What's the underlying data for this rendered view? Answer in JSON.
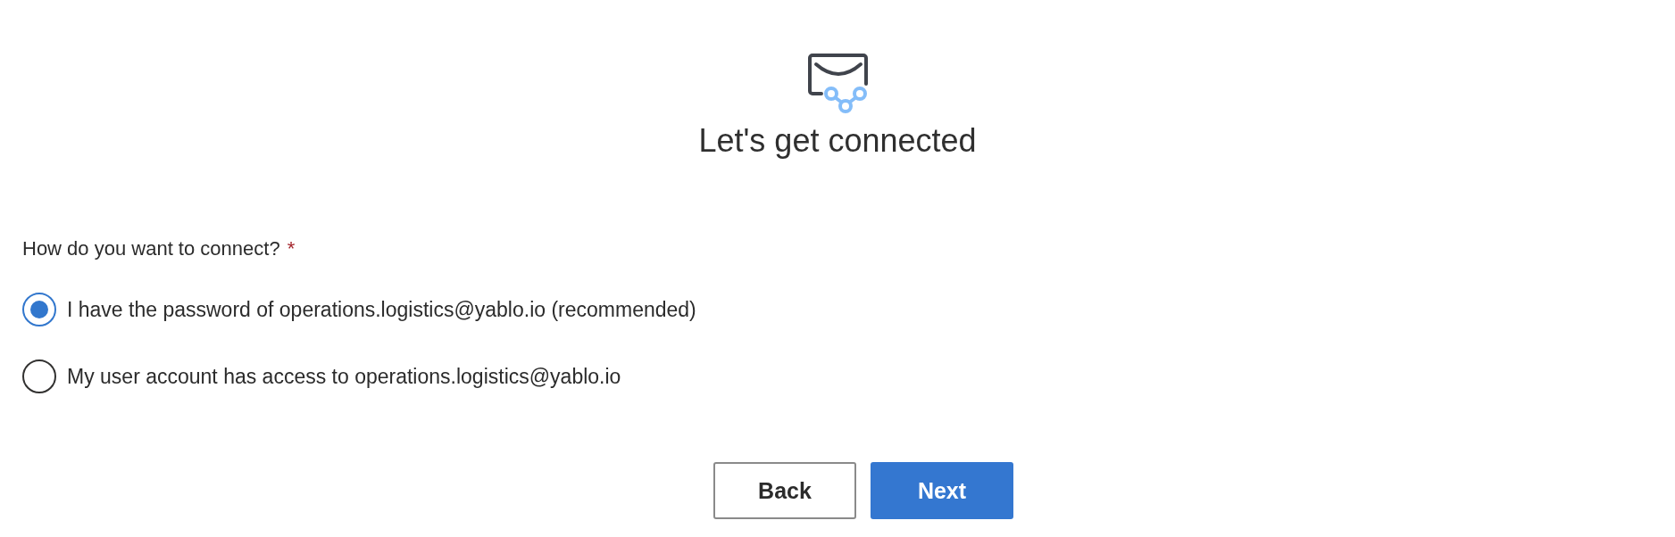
{
  "title": "Let's get connected",
  "question": {
    "label": "How do you want to connect?",
    "required_mark": "*"
  },
  "options": [
    {
      "label": "I have the password of operations.logistics@yablo.io (recommended)",
      "selected": true
    },
    {
      "label": "My user account has access to operations.logistics@yablo.io",
      "selected": false
    }
  ],
  "buttons": [
    {
      "label": "Back",
      "kind": "secondary"
    },
    {
      "label": "Next",
      "kind": "primary"
    }
  ]
}
